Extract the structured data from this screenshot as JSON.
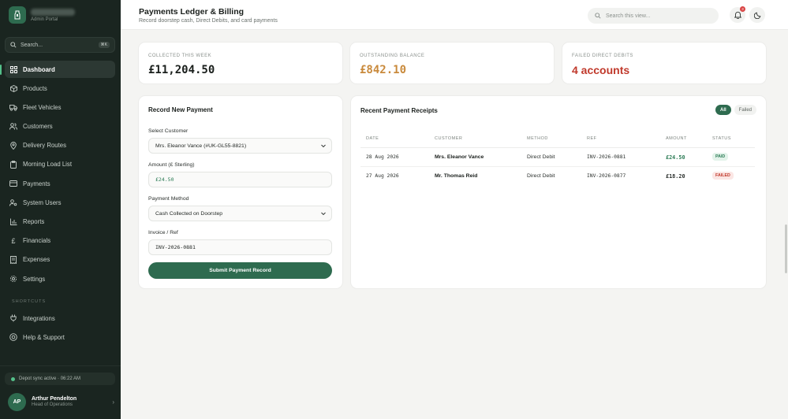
{
  "sidebar": {
    "brand_sub": "Admin Portal",
    "search_placeholder": "Search...",
    "search_shortcut": "⌘K",
    "items": [
      {
        "label": "Dashboard",
        "icon": "grid-icon"
      },
      {
        "label": "Products",
        "icon": "box-icon"
      },
      {
        "label": "Fleet Vehicles",
        "icon": "truck-icon"
      },
      {
        "label": "Customers",
        "icon": "users-icon"
      },
      {
        "label": "Delivery Routes",
        "icon": "map-pin-icon"
      },
      {
        "label": "Morning Load List",
        "icon": "clipboard-icon"
      },
      {
        "label": "Payments",
        "icon": "credit-card-icon"
      },
      {
        "label": "System Users",
        "icon": "user-cog-icon"
      },
      {
        "label": "Reports",
        "icon": "bar-chart-icon"
      },
      {
        "label": "Financials",
        "icon": "pound-icon"
      },
      {
        "label": "Expenses",
        "icon": "receipt-icon"
      },
      {
        "label": "Settings",
        "icon": "gear-icon"
      }
    ],
    "shortcuts_label": "SHORTCUTS",
    "shortcuts": [
      {
        "label": "Integrations",
        "icon": "plug-icon"
      },
      {
        "label": "Help & Support",
        "icon": "lifebuoy-icon"
      }
    ],
    "sync_status": "Depot sync active · 06:22 AM",
    "user": {
      "initials": "AP",
      "name": "Arthur Pendelton",
      "role": "Head of Operations"
    }
  },
  "header": {
    "title": "Payments Ledger & Billing",
    "subtitle": "Record doorstep cash, Direct Debits, and card payments",
    "search_placeholder": "Search this view...",
    "notification_count": "3"
  },
  "stats": {
    "collected_label": "COLLECTED THIS WEEK",
    "collected_value": "£11,204.50",
    "outstanding_label": "OUTSTANDING BALANCE",
    "outstanding_value": "£842.10",
    "failed_label": "FAILED DIRECT DEBITS",
    "failed_value": "4 accounts"
  },
  "form": {
    "title": "Record New Payment",
    "customer_label": "Select Customer",
    "customer_value": "Mrs. Eleanor Vance (#UK-GL55-8821)",
    "amount_label": "Amount (£ Sterling)",
    "amount_value": "£24.50",
    "method_label": "Payment Method",
    "method_value": "Cash Collected on Doorstep",
    "ref_label": "Invoice / Ref",
    "ref_value": "INV-2026-0881",
    "submit_label": "Submit Payment Record"
  },
  "receipts": {
    "title": "Recent Payment Receipts",
    "filters": {
      "all": "All",
      "failed": "Failed"
    },
    "columns": {
      "date": "DATE",
      "customer": "CUSTOMER",
      "method": "METHOD",
      "ref": "REF",
      "amount": "AMOUNT",
      "status": "STATUS"
    },
    "rows": [
      {
        "date": "28 Aug 2026",
        "customer": "Mrs. Eleanor Vance",
        "method": "Direct Debit",
        "ref": "INV-2026-0881",
        "amount": "£24.50",
        "status": "PAID"
      },
      {
        "date": "27 Aug 2026",
        "customer": "Mr. Thomas Reid",
        "method": "Direct Debit",
        "ref": "INV-2026-0877",
        "amount": "£18.20",
        "status": "FAILED"
      }
    ]
  },
  "colors": {
    "accent": "#2e6b4f",
    "sidebar": "#1a2520",
    "success": "#2e7d57",
    "danger": "#c0392b",
    "warning": "#c98a3c"
  }
}
